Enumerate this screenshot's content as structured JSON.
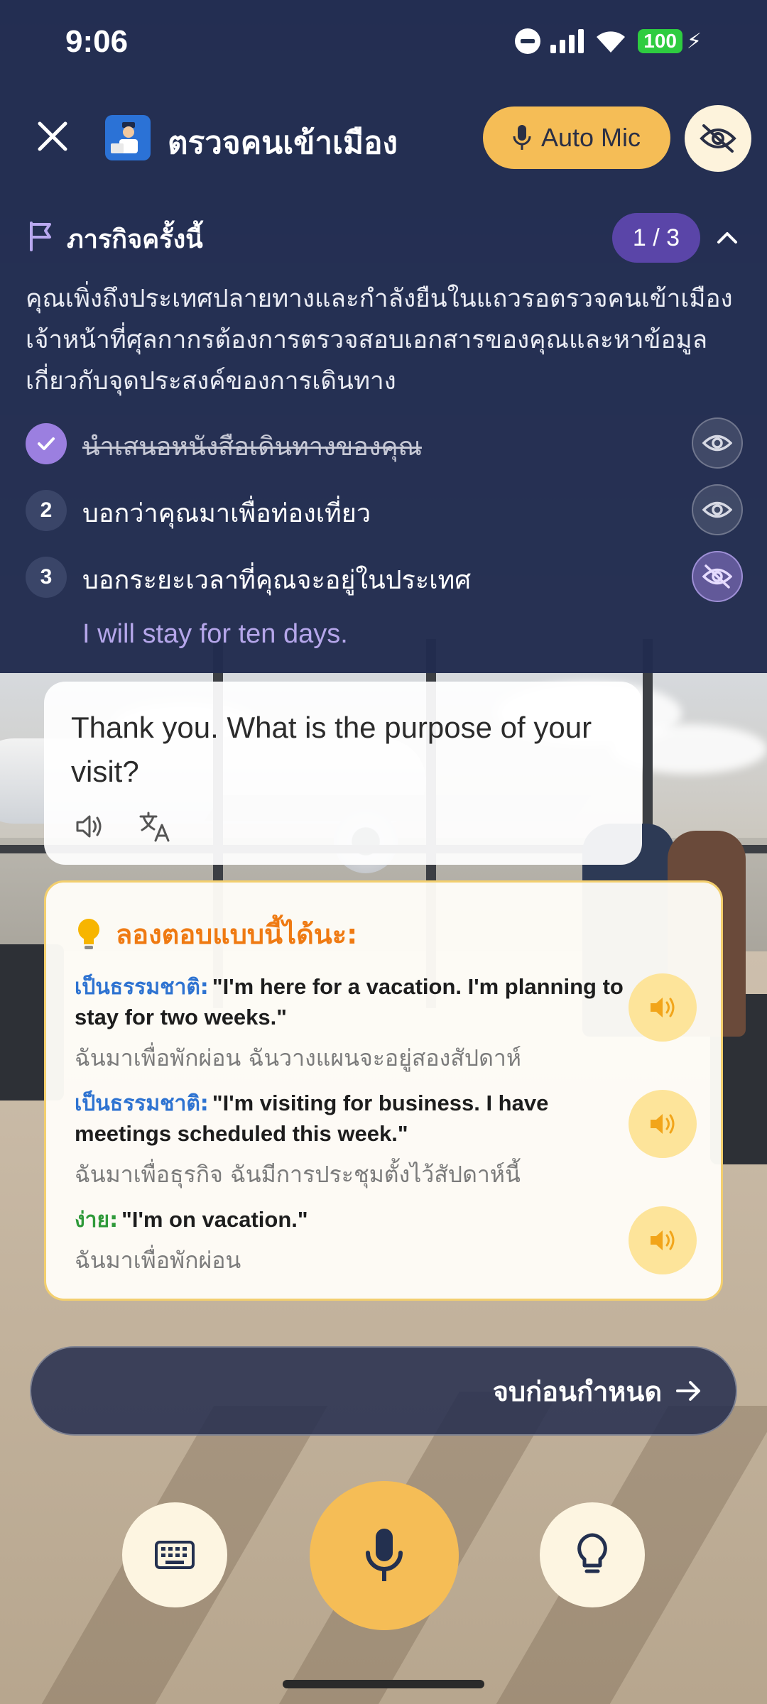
{
  "status_bar": {
    "time": "9:06",
    "battery": "100"
  },
  "header": {
    "title": "ตรวจคนเข้าเมือง",
    "auto_mic_label": "Auto Mic"
  },
  "mission": {
    "title": "ภารกิจครั้งนี้",
    "progress": "1 / 3",
    "description": "คุณเพิ่งถึงประเทศปลายทางและกำลังยืนในแถวรอตรวจคนเข้าเมือง เจ้าหน้าที่ศุลกากรต้องการตรวจสอบเอกสารของคุณและหาข้อมูลเกี่ยวกับจุดประสงค์ของการเดินทาง",
    "tasks": [
      {
        "num": "✓",
        "text": "นำเสนอหนังสือเดินทางของคุณ",
        "done": true
      },
      {
        "num": "2",
        "text": "บอกว่าคุณมาเพื่อท่องเที่ยว",
        "done": false
      },
      {
        "num": "3",
        "text": "บอกระยะเวลาที่คุณจะอยู่ในประเทศ",
        "done": false
      }
    ],
    "hint": "I will stay for ten days."
  },
  "bot_message": {
    "text": "Thank you. What is the purpose of your visit?"
  },
  "suggestions": {
    "title": "ลองตอบแบบนี้ได้นะ:",
    "items": [
      {
        "tag": "เป็นธรรมชาติ:",
        "english": "\"I'm here for a vacation. I'm planning to stay for two weeks.\"",
        "thai": "ฉันมาเพื่อพักผ่อน ฉันวางแผนจะอยู่สองสัปดาห์"
      },
      {
        "tag": "เป็นธรรมชาติ:",
        "english": "\"I'm visiting for business. I have meetings scheduled this week.\"",
        "thai": "ฉันมาเพื่อธุรกิจ ฉันมีการประชุมตั้งไว้สัปดาห์นี้"
      },
      {
        "tag": "ง่าย:",
        "english": "\"I'm on vacation.\"",
        "thai": "ฉันมาเพื่อพักผ่อน"
      }
    ]
  },
  "end_early_label": "จบก่อนกำหนด",
  "colors": {
    "panel": "#212b4e",
    "accent_yellow": "#f5bd56",
    "accent_purple": "#5a45a8",
    "suggestion_orange": "#ef7a12",
    "tag_blue": "#2e73d1",
    "tag_green": "#2f9a3a"
  },
  "icons": [
    "close-icon",
    "immigration-officer-icon",
    "microphone-icon",
    "eye-off-icon",
    "flag-icon",
    "chevron-up-icon",
    "check-icon",
    "eye-icon",
    "speaker-icon",
    "translate-icon",
    "lightbulb-icon",
    "volume-icon",
    "arrow-right-icon",
    "keyboard-icon"
  ]
}
